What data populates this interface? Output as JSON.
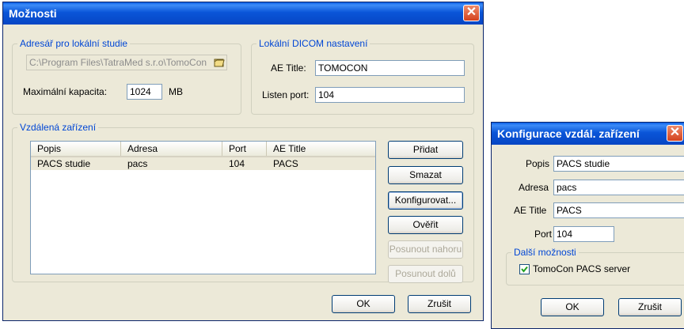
{
  "main_dialog": {
    "title": "Možnosti",
    "local_folder_group": {
      "legend": "Adresář pro lokální studie",
      "path_value": "C:\\Program Files\\TatraMed s.r.o\\TomoCon",
      "max_capacity_label": "Maximální kapacita:",
      "max_capacity_value": "1024",
      "max_capacity_unit": "MB"
    },
    "dicom_group": {
      "legend": "Lokální DICOM nastavení",
      "ae_title_label": "AE Title:",
      "ae_title_value": "TOMOCON",
      "listen_port_label": "Listen port:",
      "listen_port_value": "104"
    },
    "remote_group": {
      "legend": "Vzdálená zařízení",
      "columns": [
        "Popis",
        "Adresa",
        "Port",
        "AE Title"
      ],
      "rows": [
        {
          "popis": "PACS studie",
          "adresa": "pacs",
          "port": "104",
          "ae_title": "PACS"
        }
      ],
      "buttons": {
        "add": "Přidat",
        "delete": "Smazat",
        "configure": "Konfigurovat...",
        "verify": "Ověřit",
        "move_up": "Posunout nahoru",
        "move_down": "Posunout dolů"
      }
    },
    "ok": "OK",
    "cancel": "Zrušit"
  },
  "config_dialog": {
    "title": "Konfigurace vzdál. zařízení",
    "popis_label": "Popis",
    "popis_value": "PACS studie",
    "adresa_label": "Adresa",
    "adresa_value": "pacs",
    "ae_title_label": "AE Title",
    "ae_title_value": "PACS",
    "port_label": "Port",
    "port_value": "104",
    "more_options_legend": "Další možnosti",
    "tomocon_checkbox_label": "TomoCon PACS server",
    "tomocon_checked": true,
    "ok": "OK",
    "cancel": "Zrušit"
  },
  "colors": {
    "title_bar": "#0a55d8",
    "dialog_bg": "#ece9d8",
    "legend_text": "#0046d5",
    "close_button": "#d3421e"
  }
}
